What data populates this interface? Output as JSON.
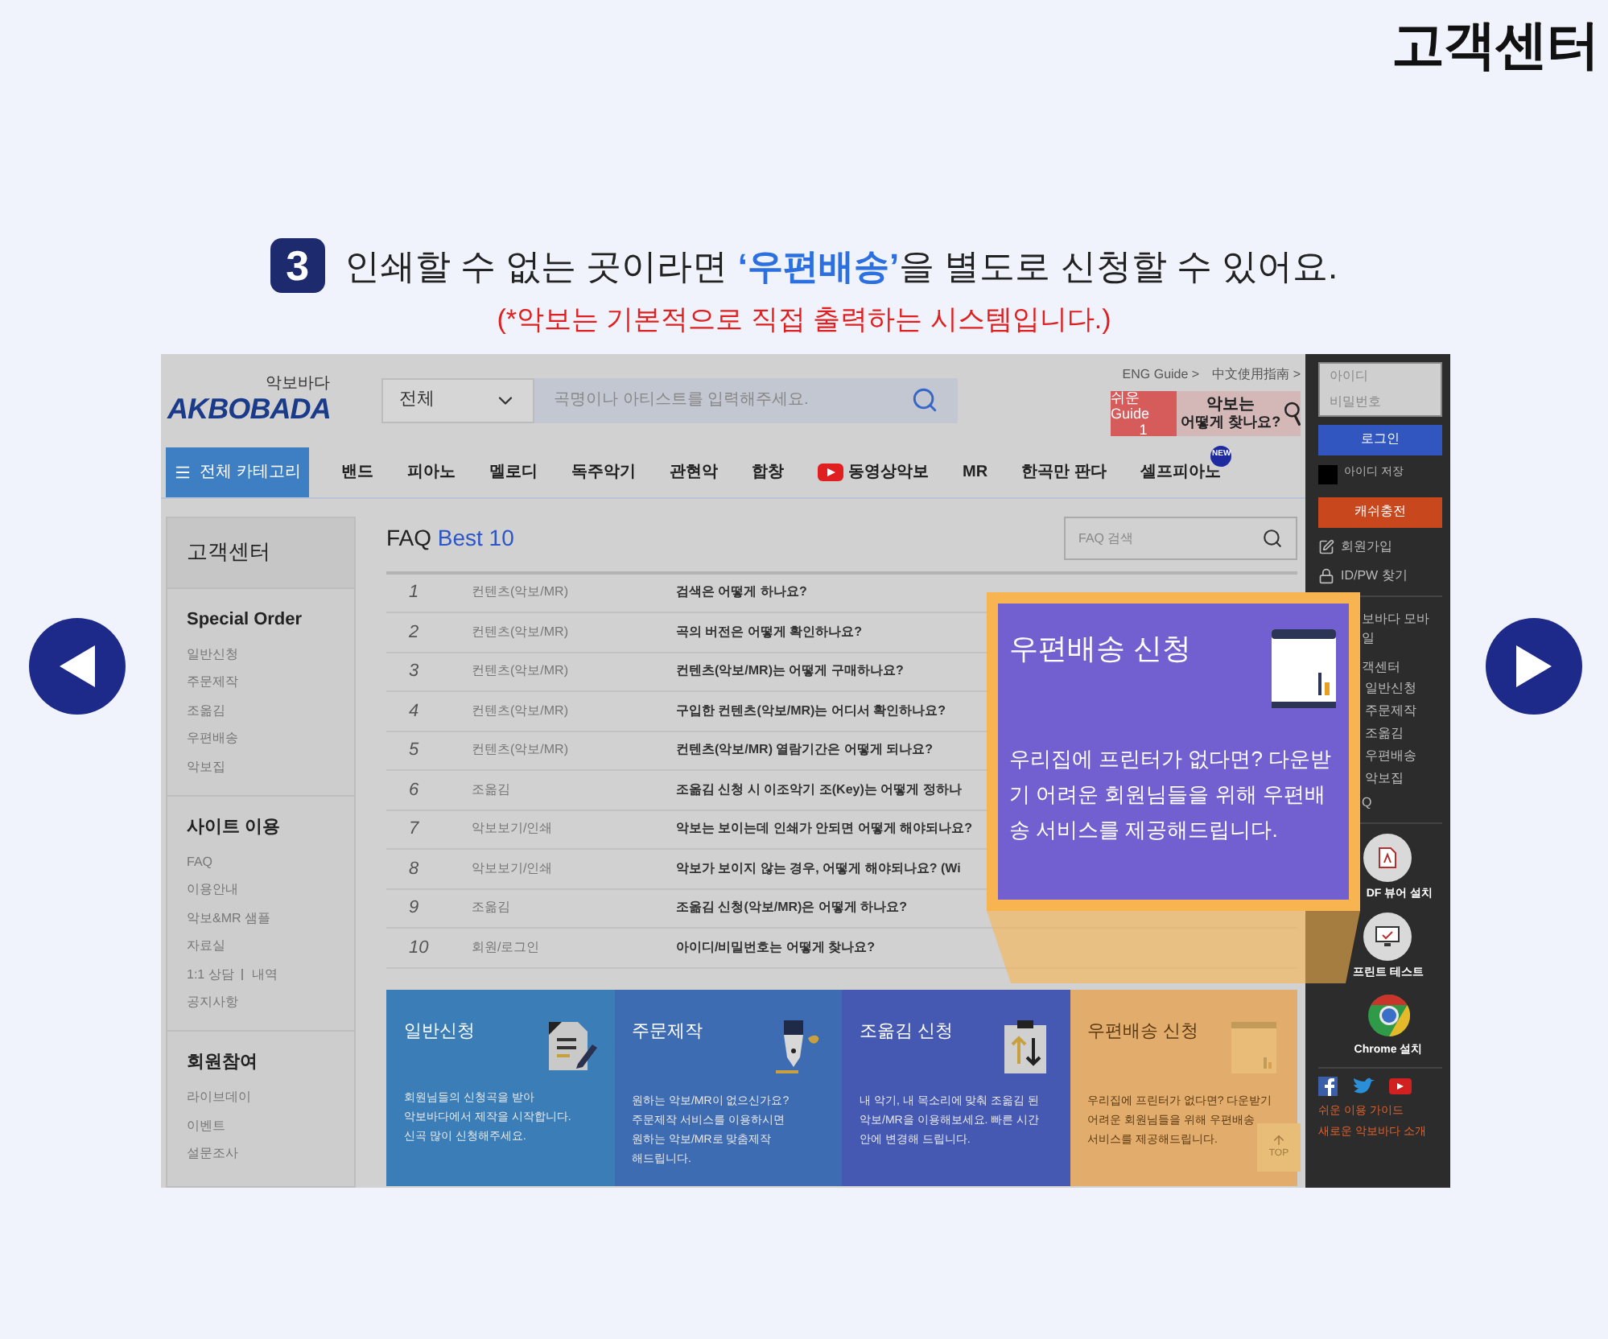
{
  "page_title": "고객센터",
  "step": {
    "number": "3",
    "before": "인쇄할 수 없는 곳이라면 ",
    "highlight": "‘우편배송’",
    "after": "을 별도로 신청할 수 있어요.",
    "note": "(*악보는 기본적으로 직접 출력하는 시스템입니다.)"
  },
  "site": {
    "logo": {
      "small": "악보바다",
      "name": "AKBOBADA"
    },
    "search": {
      "scope": "전체",
      "placeholder": "곡명이나 아티스트를 입력해주세요."
    },
    "lang_links": [
      "ENG Guide >",
      "中文使用指南 >"
    ],
    "guide_banner": {
      "tag": "쉬운 Guide",
      "number": "1",
      "line1": "악보는",
      "line2": "어떻게 찾나요?"
    },
    "category_button": "전체 카테고리",
    "nav": [
      {
        "label": "밴드",
        "kind": "plain"
      },
      {
        "label": "피아노",
        "kind": "plain"
      },
      {
        "label": "멜로디",
        "kind": "plain"
      },
      {
        "label": "독주악기",
        "kind": "plain"
      },
      {
        "label": "관현악",
        "kind": "plain"
      },
      {
        "label": "합창",
        "kind": "plain"
      },
      {
        "label": "동영상악보",
        "kind": "video"
      },
      {
        "label": "MR",
        "kind": "plain"
      },
      {
        "label": "한곡만 판다",
        "kind": "plain"
      },
      {
        "label": "셀프피아노",
        "kind": "new",
        "badge": "NEW"
      }
    ],
    "sidebar": {
      "title": "고객센터",
      "sections": [
        {
          "title": "Special Order",
          "items": [
            {
              "label": "일반신청"
            },
            {
              "label": "주문제작"
            },
            {
              "label": "조옮김"
            },
            {
              "label": "우편배송"
            },
            {
              "label": "악보집"
            }
          ]
        },
        {
          "title": "사이트 이용",
          "items": [
            {
              "label": "FAQ"
            },
            {
              "label": "이용안내"
            },
            {
              "label": "악보&MR 샘플"
            },
            {
              "label": "자료실"
            },
            {
              "label": "1:1 상담",
              "extra": "내역"
            },
            {
              "label": "공지사항"
            }
          ]
        },
        {
          "title": "회원참여",
          "items": [
            {
              "label": "라이브데이"
            },
            {
              "label": "이벤트"
            },
            {
              "label": "설문조사"
            }
          ]
        }
      ]
    },
    "faq": {
      "title": "FAQ",
      "highlight": "Best 10",
      "search_placeholder": "FAQ 검색",
      "rows": [
        {
          "number": "1",
          "category": "컨텐츠(악보/MR)",
          "question": "검색은 어떻게 하나요?"
        },
        {
          "number": "2",
          "category": "컨텐츠(악보/MR)",
          "question": "곡의 버전은 어떻게 확인하나요?"
        },
        {
          "number": "3",
          "category": "컨텐츠(악보/MR)",
          "question": "컨텐츠(악보/MR)는 어떻게 구매하나요?"
        },
        {
          "number": "4",
          "category": "컨텐츠(악보/MR)",
          "question": "구입한 컨텐츠(악보/MR)는 어디서 확인하나요?"
        },
        {
          "number": "5",
          "category": "컨텐츠(악보/MR)",
          "question": "컨텐츠(악보/MR) 열람기간은 어떻게 되나요?"
        },
        {
          "number": "6",
          "category": "조옮김",
          "question": "조옮김 신청 시 이조악기 조(Key)는 어떻게 정하나"
        },
        {
          "number": "7",
          "category": "악보보기/인쇄",
          "question": "악보는 보이는데 인쇄가 안되면 어떻게 해야되나요?"
        },
        {
          "number": "8",
          "category": "악보보기/인쇄",
          "question": "악보가 보이지 않는 경우, 어떻게 해야되나요? (Wi"
        },
        {
          "number": "9",
          "category": "조옮김",
          "question": "조옮김 신청(악보/MR)은 어떻게 하나요?"
        },
        {
          "number": "10",
          "category": "회원/로그인",
          "question": "아이디/비밀번호는 어떻게 찾나요?"
        }
      ]
    },
    "cards": [
      {
        "kind": "document",
        "title": "일반신청",
        "lines": [
          "회원님들의 신청곡을 받아",
          "악보바다에서 제작을 시작합니다.",
          "신곡 많이 신청해주세요."
        ]
      },
      {
        "kind": "pen",
        "title": "주문제작",
        "lines": [
          "원하는 악보/MR이 없으신가요?",
          "주문제작 서비스를 이용하시면",
          "원하는 악보/MR로 맞춤제작",
          "해드립니다."
        ]
      },
      {
        "kind": "transpose",
        "title": "조옮김 신청",
        "lines": [
          "내 악기, 내 목소리에 맞춰 조옮김 된",
          "악보/MR을 이용해보세요. 빠른 시간",
          "안에 변경해 드립니다."
        ]
      },
      {
        "kind": "box",
        "title": "우편배송 신청",
        "lines": [
          "우리집에 프린터가 없다면? 다운받기",
          "어려운 회원님들을 위해 우편배송",
          "서비스를 제공해드립니다."
        ]
      }
    ],
    "top_button": "TOP",
    "user_panel": {
      "id_placeholder": "아이디",
      "pw_placeholder": "비밀번호",
      "login": "로그인",
      "save_id": {
        "label": "아이디 저장",
        "checked": false
      },
      "cash": "캐쉬충전",
      "links": [
        {
          "kind": "signup",
          "label": "회원가입"
        },
        {
          "kind": "lock",
          "label": "ID/PW 찾기"
        }
      ],
      "menu_title": "보바다 모바일",
      "menu_section": "객센터",
      "menu_items": [
        "일반신청",
        "주문제작",
        "조옮김",
        "우편배송",
        "악보집"
      ],
      "menu_last": "Q",
      "tools": [
        {
          "kind": "pdf",
          "label": "DF 뷰어 설치"
        },
        {
          "kind": "print",
          "label": "프린트 테스트"
        },
        {
          "kind": "chrome",
          "label": "Chrome 설치"
        }
      ],
      "bottom_links": [
        "쉬운 이용 가이드",
        "새로운 악보바다 소개"
      ]
    }
  },
  "popup": {
    "title": "우편배송 신청",
    "text": "우리집에 프린터가 없다면? 다운받기 어려운 회원님들을 위해 우편배송 서비스를 제공해드립니다."
  }
}
